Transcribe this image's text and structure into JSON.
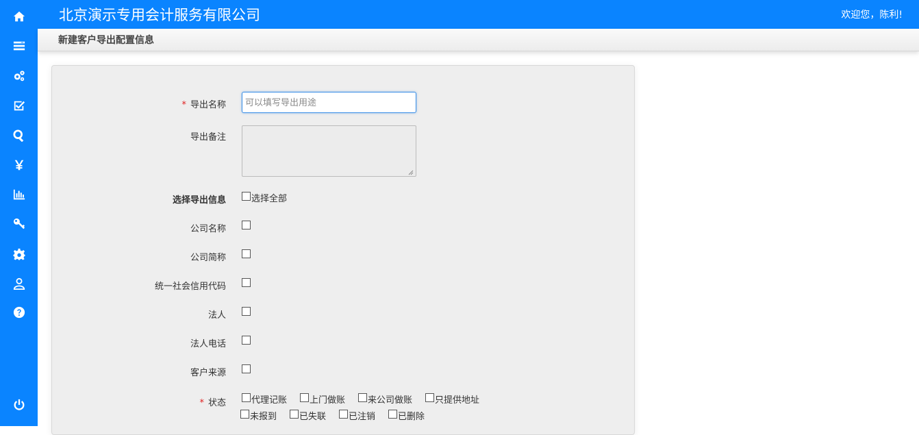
{
  "header": {
    "company": "北京演示专用会计服务有限公司",
    "welcome": "欢迎您，陈利!"
  },
  "subheader": {
    "title": "新建客户导出配置信息"
  },
  "sidebar": {
    "icons": [
      "home-icon",
      "list-icon",
      "gears-icon",
      "check-square-icon",
      "search-icon",
      "yen-icon",
      "bar-chart-icon",
      "key-icon",
      "gear-icon",
      "user-icon",
      "help-icon",
      "power-icon"
    ]
  },
  "form": {
    "export_name": {
      "label": "导出名称",
      "required_mark": "*",
      "placeholder": "可以填写导出用途"
    },
    "export_note": {
      "label": "导出备注"
    },
    "select_info": {
      "label": "选择导出信息",
      "select_all": "选择全部"
    },
    "fields": [
      {
        "label": "公司名称"
      },
      {
        "label": "公司简称"
      },
      {
        "label": "统一社会信用代码"
      },
      {
        "label": "法人"
      },
      {
        "label": "法人电话"
      },
      {
        "label": "客户来源"
      }
    ],
    "status": {
      "label": "状态",
      "required_mark": "*",
      "options": [
        "代理记账",
        "上门做账",
        "来公司做账",
        "只提供地址",
        "未报到",
        "已失联",
        "已注销",
        "已删除"
      ]
    }
  }
}
